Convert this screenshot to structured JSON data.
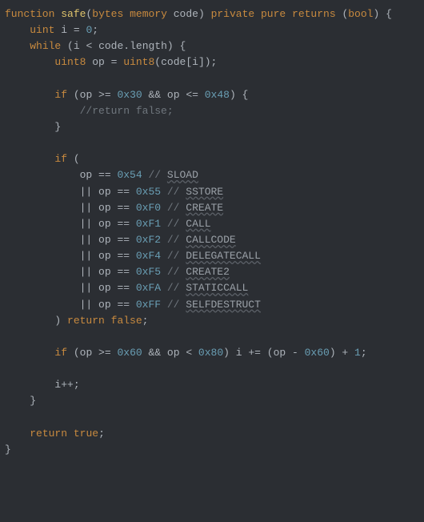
{
  "sig": {
    "kw_function": "function",
    "name": "safe",
    "lparen": "(",
    "argtype": "bytes",
    "memory": "memory",
    "argname": "code",
    "rparen": ")",
    "private": "private",
    "pure": "pure",
    "returns": "returns",
    "ret_l": "(",
    "rettype": "bool",
    "ret_r": ")",
    "brace": " {"
  },
  "l1": {
    "type": "uint",
    "id": "i",
    "eq": " = ",
    "val": "0",
    "semi": ";"
  },
  "l2": {
    "kw": "while",
    "open": " (",
    "id": "i",
    "lt": " < ",
    "obj": "code",
    "dot": ".",
    "prop": "length",
    "close": ") {"
  },
  "l3": {
    "type": "uint8",
    "id": "op",
    "eq": " = ",
    "cast": "uint8",
    "open": "(",
    "obj": "code",
    "br_l": "[",
    "idx": "i",
    "br_r": "]",
    "close": ");"
  },
  "if1": {
    "kw": "if",
    "open": " (",
    "id1": "op",
    "ge": " >= ",
    "v1": "0x30",
    "and": " && ",
    "id2": "op",
    "le": " <= ",
    "v2": "0x48",
    "close": ") {"
  },
  "if1c": {
    "txt": "//return false;"
  },
  "if1end": {
    "txt": "}"
  },
  "if2": {
    "kw": "if",
    "open": " ("
  },
  "c0": {
    "id": "op",
    "eq": " == ",
    "val": "0x54",
    "slashes": " // ",
    "name": "SLOAD"
  },
  "c1": {
    "or": "|| ",
    "id": "op",
    "eq": " == ",
    "val": "0x55",
    "slashes": " // ",
    "name": "SSTORE"
  },
  "c2": {
    "or": "|| ",
    "id": "op",
    "eq": " == ",
    "val": "0xF0",
    "slashes": " // ",
    "name": "CREATE"
  },
  "c3": {
    "or": "|| ",
    "id": "op",
    "eq": " == ",
    "val": "0xF1",
    "slashes": " // ",
    "name": "CALL"
  },
  "c4": {
    "or": "|| ",
    "id": "op",
    "eq": " == ",
    "val": "0xF2",
    "slashes": " // ",
    "name": "CALLCODE"
  },
  "c5": {
    "or": "|| ",
    "id": "op",
    "eq": " == ",
    "val": "0xF4",
    "slashes": " // ",
    "name": "DELEGATECALL"
  },
  "c6": {
    "or": "|| ",
    "id": "op",
    "eq": " == ",
    "val": "0xF5",
    "slashes": " // ",
    "name": "CREATE2"
  },
  "c7": {
    "or": "|| ",
    "id": "op",
    "eq": " == ",
    "val": "0xFA",
    "slashes": " // ",
    "name": "STATICCALL"
  },
  "c8": {
    "or": "|| ",
    "id": "op",
    "eq": " == ",
    "val": "0xFF",
    "slashes": " // ",
    "name": "SELFDESTRUCT"
  },
  "if2close": {
    "paren": ") ",
    "ret": "return",
    "sp": " ",
    "val": "false",
    "semi": ";"
  },
  "if3": {
    "kw": "if",
    "open": " (",
    "id1": "op",
    "ge": " >= ",
    "v1": "0x60",
    "and": " && ",
    "id2": "op",
    "lt": " < ",
    "v2": "0x80",
    "close": ") ",
    "lhs": "i",
    "peq": " += (",
    "id3": "op",
    "minus": " - ",
    "v3": "0x60",
    "tail": ") + ",
    "one": "1",
    "semi": ";"
  },
  "inc": {
    "id": "i",
    "pp": "++;"
  },
  "endwhile": {
    "txt": "}"
  },
  "rettrue": {
    "ret": "return",
    "sp": " ",
    "val": "true",
    "semi": ";"
  },
  "endfn": {
    "txt": "}"
  }
}
